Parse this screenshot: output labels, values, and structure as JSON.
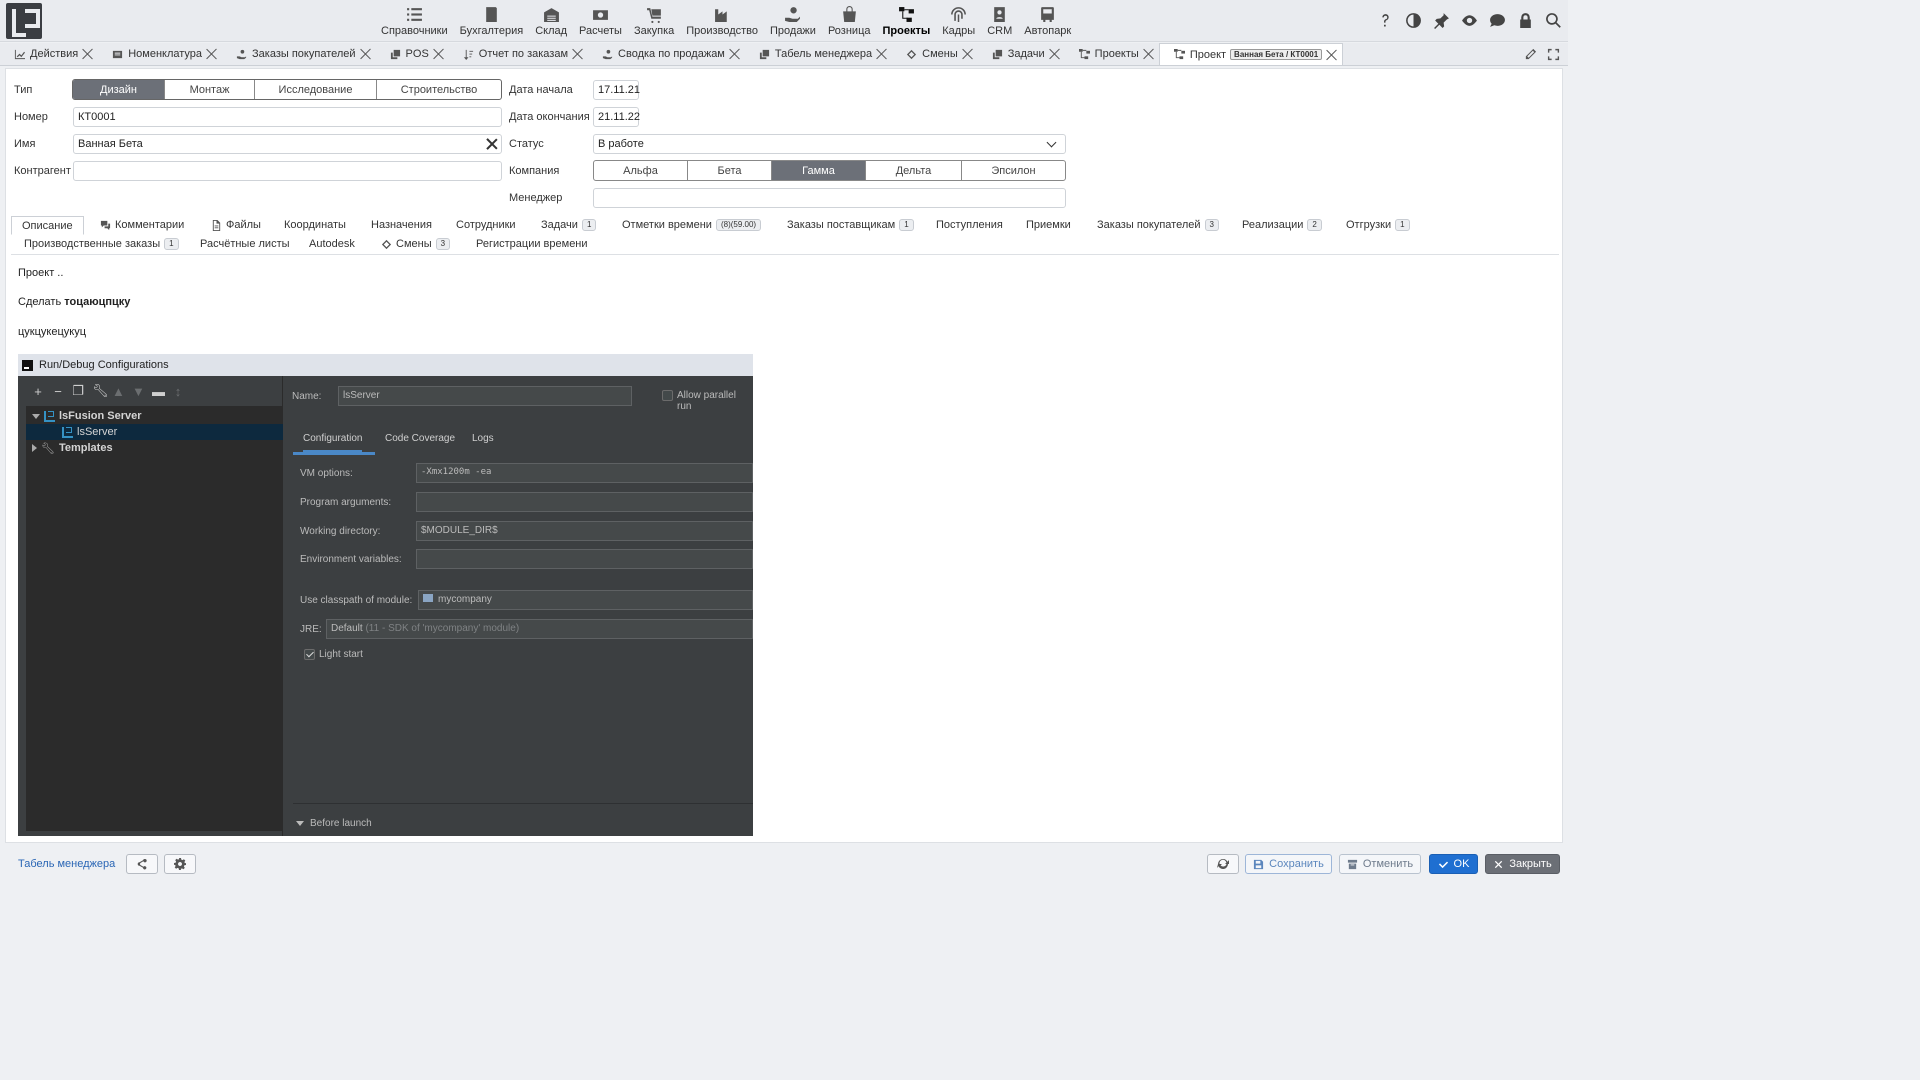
{
  "nav": {
    "items": [
      {
        "label": "Справочники",
        "icon": "list-icon"
      },
      {
        "label": "Бухгалтерия",
        "icon": "ledger-icon"
      },
      {
        "label": "Склад",
        "icon": "warehouse-icon"
      },
      {
        "label": "Расчеты",
        "icon": "money-icon"
      },
      {
        "label": "Закупка",
        "icon": "cart-icon"
      },
      {
        "label": "Производство",
        "icon": "factory-icon"
      },
      {
        "label": "Продажи",
        "icon": "hand-coin-icon"
      },
      {
        "label": "Розница",
        "icon": "shopping-bag-icon"
      },
      {
        "label": "Проекты",
        "icon": "project-tree-icon",
        "active": true
      },
      {
        "label": "Кадры",
        "icon": "fingerprint-icon"
      },
      {
        "label": "CRM",
        "icon": "contact-card-icon"
      },
      {
        "label": "Автопарк",
        "icon": "bus-icon"
      }
    ]
  },
  "tabs": [
    {
      "label": "Действия",
      "icon": "chart-icon"
    },
    {
      "label": "Номенклатура",
      "icon": "catalog-icon"
    },
    {
      "label": "Заказы покупателей",
      "icon": "hand-coin-icon"
    },
    {
      "label": "POS",
      "icon": "copy-icon"
    },
    {
      "label": "Отчет по заказам",
      "icon": "sort-icon"
    },
    {
      "label": "Сводка по продажам",
      "icon": "hand-coin-icon"
    },
    {
      "label": "Табель менеджера",
      "icon": "copy-icon"
    },
    {
      "label": "Смены",
      "icon": "diamond-icon"
    },
    {
      "label": "Задачи",
      "icon": "copy-icon"
    },
    {
      "label": "Проекты",
      "icon": "project-tree-icon"
    },
    {
      "label": "Проект",
      "icon": "project-tree-icon",
      "badge": "Ванная Бета / КТ0001",
      "active": true
    }
  ],
  "form": {
    "type_label": "Тип",
    "type_options": [
      "Дизайн",
      "Монтаж",
      "Исследование",
      "Строительство"
    ],
    "type_selected": "Дизайн",
    "number_label": "Номер",
    "number_value": "КТ0001",
    "name_label": "Имя",
    "name_value": "Ванная Бета",
    "counterparty_label": "Контрагент",
    "counterparty_value": "",
    "start_label": "Дата начала",
    "start_value": "17.11.21",
    "end_label": "Дата окончания",
    "end_value": "21.11.22",
    "status_label": "Статус",
    "status_value": "В работе",
    "company_label": "Компания",
    "company_options": [
      "Альфа",
      "Бета",
      "Гамма",
      "Дельта",
      "Эпсилон"
    ],
    "company_selected": "Гамма",
    "manager_label": "Менеджер",
    "manager_value": ""
  },
  "subtabs": {
    "row1": [
      {
        "label": "Описание",
        "active": true
      },
      {
        "label": "Комментарии",
        "icon": "comments-icon"
      },
      {
        "label": "Файлы",
        "icon": "file-icon"
      },
      {
        "label": "Координаты"
      },
      {
        "label": "Назначения"
      },
      {
        "label": "Сотрудники"
      },
      {
        "label": "Задачи",
        "badge": "1"
      },
      {
        "label": "Отметки времени",
        "badge": "(8)(59.00)"
      },
      {
        "label": "Заказы поставщикам",
        "badge": "1"
      },
      {
        "label": "Поступления"
      },
      {
        "label": "Приемки"
      },
      {
        "label": "Заказы покупателей",
        "badge": "3"
      },
      {
        "label": "Реализации",
        "badge": "2"
      },
      {
        "label": "Отгрузки",
        "badge": "1"
      }
    ],
    "row2": [
      {
        "label": "Производственные заказы",
        "badge": "1"
      },
      {
        "label": "Расчётные листы"
      },
      {
        "label": "Autodesk"
      },
      {
        "label": "Смены",
        "badge": "3",
        "icon": "diamond-icon"
      },
      {
        "label": "Регистрации времени"
      }
    ]
  },
  "description": {
    "line1": "Проект ..",
    "line2_prefix": "Сделать ",
    "line2_bold": "тоцаюцпцку",
    "line3": "цукцукецукуц"
  },
  "ide": {
    "title": "Run/Debug Configurations",
    "tree": {
      "group": "lsFusion Server",
      "item": "lsServer",
      "templates": "Templates"
    },
    "name_label": "Name:",
    "name_value": "lsServer",
    "allow_parallel": "Allow parallel run",
    "tabs": [
      "Configuration",
      "Code Coverage",
      "Logs"
    ],
    "vm_label": "VM options:",
    "vm_value": "-Xmx1200m -ea",
    "args_label": "Program arguments:",
    "args_value": "",
    "wd_label": "Working directory:",
    "wd_value": "$MODULE_DIR$",
    "env_label": "Environment variables:",
    "env_value": "",
    "classpath_label": "Use classpath of module:",
    "classpath_value": "mycompany",
    "jre_label": "JRE:",
    "jre_value": "Default",
    "jre_hint": "(11 - SDK of 'mycompany' module)",
    "light_start": "Light start",
    "before_launch": "Before launch"
  },
  "bottom": {
    "link": "Табель менеджера",
    "save": "Сохранить",
    "cancel": "Отменить",
    "ok": "OK",
    "close": "Закрыть"
  }
}
